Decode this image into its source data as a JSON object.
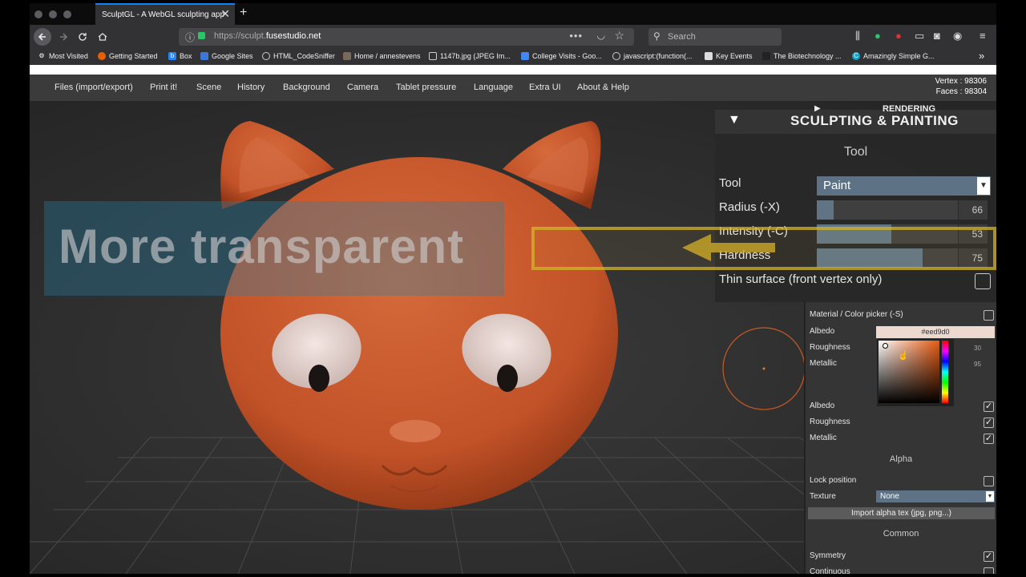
{
  "browser": {
    "tab_title": "SculptGL - A WebGL sculpting app",
    "tab_close": "✕",
    "new_tab": "+",
    "url_prefix": "https://sculpt.",
    "url_domain": "fusestudio.net",
    "search_placeholder": "Search",
    "bookmarks": [
      {
        "label": "Most Visited",
        "icon": "gear-icon"
      },
      {
        "label": "Getting Started",
        "icon": "firefox-icon"
      },
      {
        "label": "Box",
        "icon": "box-icon"
      },
      {
        "label": "Google Sites",
        "icon": "sites-icon"
      },
      {
        "label": "HTML_CodeSniffer",
        "icon": "globe-icon"
      },
      {
        "label": "Home / annestevens",
        "icon": "avatar-icon"
      },
      {
        "label": "1147b.jpg (JPEG Im...",
        "icon": "image-icon"
      },
      {
        "label": "College Visits - Goo...",
        "icon": "calendar-icon"
      },
      {
        "label": "javascript:(function(...",
        "icon": "globe-icon"
      },
      {
        "label": "Key Events",
        "icon": "page-icon"
      },
      {
        "label": "The Biotechnology ...",
        "icon": "page-icon"
      },
      {
        "label": "Amazingly Simple G...",
        "icon": "c-icon"
      }
    ],
    "overflow_chevron": "»"
  },
  "app": {
    "menu": [
      "Files (import/export)",
      "Print it!",
      "Scene",
      "History",
      "Background",
      "Camera",
      "Tablet pressure",
      "Language",
      "Extra UI",
      "About & Help"
    ],
    "vertex_info": "Vertex : 98306",
    "faces_info": "Faces : 98304",
    "overlay_text": "More transparent",
    "zoom_panel": {
      "rendering_label": "RENDERING",
      "section_title": "SCULPTING & PAINTING",
      "tool_heading": "Tool",
      "tool_label": "Tool",
      "tool_value": "Paint",
      "radius_label": "Radius (-X)",
      "radius_value": "66",
      "intensity_label": "Intensity (-C)",
      "intensity_value": "53",
      "hardness_label": "Hardness",
      "hardness_value": "75",
      "thin_surface_label": "Thin surface (front vertex only)"
    },
    "side_panel": {
      "material_label": "Material / Color picker (-S)",
      "albedo_label": "Albedo",
      "albedo_hex": "#eed9d0",
      "roughness_label": "Roughness",
      "roughness_value": "30",
      "metallic_label": "Metallic",
      "metallic_value": "95",
      "albedo2_label": "Albedo",
      "roughness2_label": "Roughness",
      "metallic2_label": "Metallic",
      "alpha_heading": "Alpha",
      "lock_position_label": "Lock position",
      "texture_label": "Texture",
      "texture_value": "None",
      "import_alpha_label": "Import alpha tex (jpg, png...)",
      "common_heading": "Common",
      "symmetry_label": "Symmetry",
      "continuous_label": "Continuous",
      "check_mark": "✓"
    }
  },
  "colors": {
    "model": "#c65a2e",
    "accent": "#0a84ff",
    "slider_fill": "#607486"
  },
  "slider_levels": {
    "radius": 0.12,
    "intensity": 0.53,
    "hardness": 0.75
  }
}
